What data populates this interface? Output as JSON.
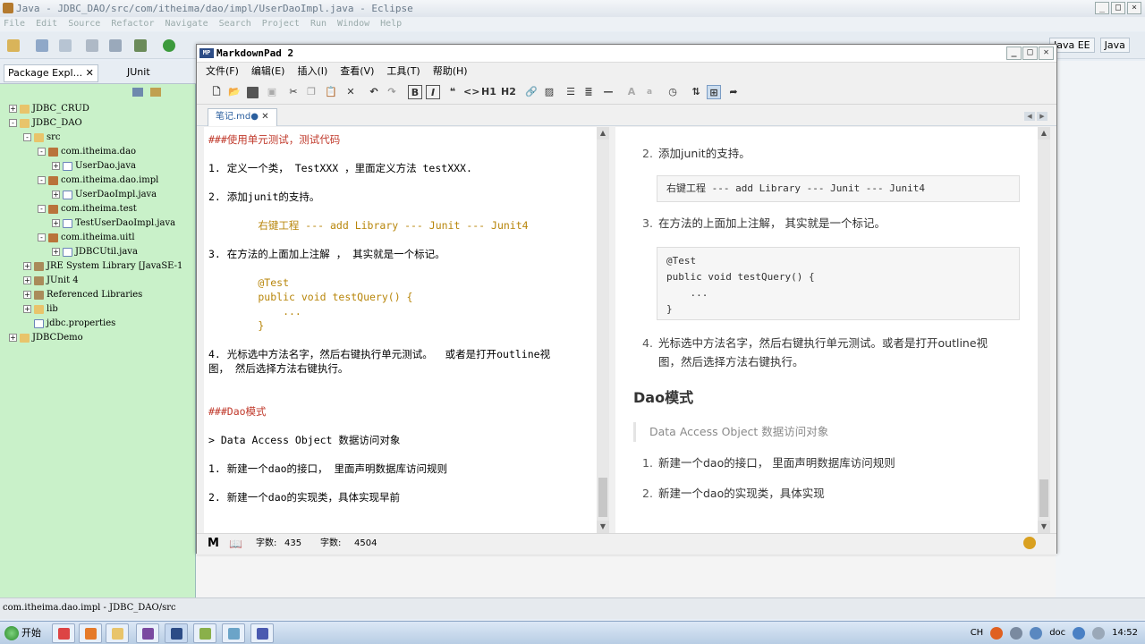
{
  "eclipse": {
    "title": "Java - JDBC_DAO/src/com/itheima/dao/impl/UserDaoImpl.java - Eclipse",
    "menu": [
      "File",
      "Edit",
      "Source",
      "Refactor",
      "Navigate",
      "Search",
      "Project",
      "Run",
      "Window",
      "Help"
    ],
    "perspectives": [
      "Java EE",
      "Java"
    ],
    "package_tabs": [
      "Package Expl...",
      "JUnit"
    ],
    "tree": [
      {
        "label": "JDBC_CRUD",
        "level": 0,
        "expander": "+",
        "icon": "project"
      },
      {
        "label": "JDBC_DAO",
        "level": 0,
        "expander": "-",
        "icon": "project"
      },
      {
        "label": "src",
        "level": 1,
        "expander": "-",
        "icon": "folder"
      },
      {
        "label": "com.itheima.dao",
        "level": 2,
        "expander": "-",
        "icon": "package"
      },
      {
        "label": "UserDao.java",
        "level": 3,
        "expander": "+",
        "icon": "java-file"
      },
      {
        "label": "com.itheima.dao.impl",
        "level": 2,
        "expander": "-",
        "icon": "package"
      },
      {
        "label": "UserDaoImpl.java",
        "level": 3,
        "expander": "+",
        "icon": "java-file"
      },
      {
        "label": "com.itheima.test",
        "level": 2,
        "expander": "-",
        "icon": "package"
      },
      {
        "label": "TestUserDaoImpl.java",
        "level": 3,
        "expander": "+",
        "icon": "java-file"
      },
      {
        "label": "com.itheima.uitl",
        "level": 2,
        "expander": "-",
        "icon": "package"
      },
      {
        "label": "JDBCUtil.java",
        "level": 3,
        "expander": "+",
        "icon": "java-file"
      },
      {
        "label": "JRE System Library [JavaSE-1",
        "level": 1,
        "expander": "+",
        "icon": "library"
      },
      {
        "label": "JUnit 4",
        "level": 1,
        "expander": "+",
        "icon": "library"
      },
      {
        "label": "Referenced Libraries",
        "level": 1,
        "expander": "+",
        "icon": "library"
      },
      {
        "label": "lib",
        "level": 1,
        "expander": "+",
        "icon": "folder"
      },
      {
        "label": "jdbc.properties",
        "level": 1,
        "expander": "",
        "icon": "file"
      },
      {
        "label": "JDBCDemo",
        "level": 0,
        "expander": "+",
        "icon": "project"
      }
    ],
    "status_text": "com.itheima.dao.impl - JDBC_DAO/src"
  },
  "markdownpad": {
    "title": "MarkdownPad 2",
    "logo": "MP",
    "menu": [
      "文件(F)",
      "编辑(E)",
      "插入(I)",
      "查看(V)",
      "工具(T)",
      "帮助(H)"
    ],
    "toolbar_text": {
      "bold": "B",
      "italic": "I",
      "quote": "❝",
      "code": "<>",
      "h1": "H1",
      "h2": "H2",
      "font_large": "A",
      "font_small": "a"
    },
    "tab_label": "笔记.md●",
    "editor_lines": [
      {
        "text": "###使用单元测试，测试代码",
        "style": "hd"
      },
      {
        "text": "",
        "style": ""
      },
      {
        "text": "1. 定义一个类， TestXXX ，里面定义方法 testXXX.",
        "style": ""
      },
      {
        "text": "",
        "style": ""
      },
      {
        "text": "2. 添加junit的支持。",
        "style": ""
      },
      {
        "text": "",
        "style": ""
      },
      {
        "text": "        右键工程 --- add Library --- Junit --- Junit4",
        "style": "cd"
      },
      {
        "text": "",
        "style": ""
      },
      {
        "text": "3. 在方法的上面加上注解 ， 其实就是一个标记。",
        "style": ""
      },
      {
        "text": "",
        "style": ""
      },
      {
        "text": "        @Test",
        "style": "cd"
      },
      {
        "text": "        public void testQuery() {",
        "style": "cd"
      },
      {
        "text": "            ...",
        "style": "cd"
      },
      {
        "text": "        }",
        "style": "cd"
      },
      {
        "text": "",
        "style": ""
      },
      {
        "text": "4. 光标选中方法名字，然后右键执行单元测试。  或者是打开outline视",
        "style": ""
      },
      {
        "text": "图， 然后选择方法右键执行。",
        "style": ""
      },
      {
        "text": "",
        "style": ""
      },
      {
        "text": "",
        "style": ""
      },
      {
        "text": "###Dao模式",
        "style": "hd"
      },
      {
        "text": "",
        "style": ""
      },
      {
        "text": "> Data Access Object 数据访问对象",
        "style": ""
      },
      {
        "text": "",
        "style": ""
      },
      {
        "text": "1. 新建一个dao的接口， 里面声明数据库访问规则",
        "style": ""
      },
      {
        "text": "",
        "style": ""
      },
      {
        "text": "2. 新建一个dao的实现类，具体实现早前",
        "style": ""
      }
    ],
    "preview": {
      "item2_num": "2.",
      "item2": "添加junit的支持。",
      "code1": "右键工程 --- add Library --- Junit --- Junit4",
      "item3_num": "3.",
      "item3": "在方法的上面加上注解， 其实就是一个标记。",
      "code2": [
        "@Test",
        "public void testQuery() {",
        "    ...",
        "}"
      ],
      "item4_num": "4.",
      "item4_line1": "光标选中方法名字，然后右键执行单元测试。或者是打开outline视",
      "item4_line2": "图，然后选择方法右键执行。",
      "heading": "Dao模式",
      "quote": "Data Access Object 数据访问对象",
      "dao1_num": "1.",
      "dao1": "新建一个dao的接口， 里面声明数据库访问规则",
      "dao2_num": "2.",
      "dao2": "新建一个dao的实现类，具体实现"
    },
    "status": {
      "words_label": "字数:",
      "words": "435",
      "chars_label": "字数:",
      "chars": "4504"
    }
  },
  "taskbar": {
    "start": "开始",
    "lang": "CH",
    "tray_text": "doc",
    "time": "14:52"
  }
}
